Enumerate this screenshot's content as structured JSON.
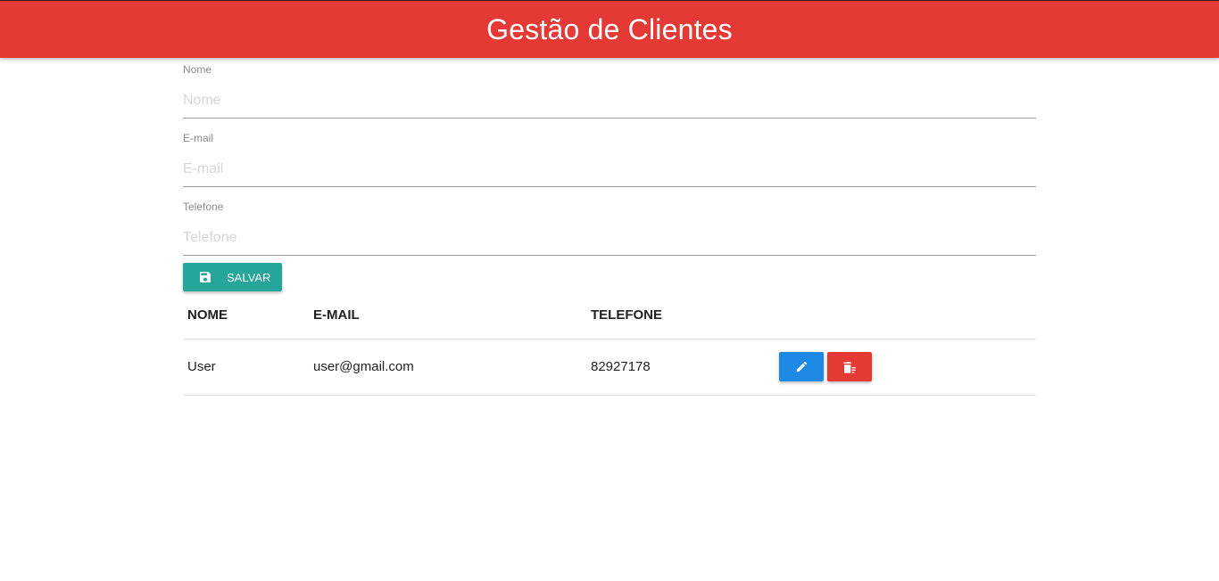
{
  "header": {
    "title": "Gestão de Clientes"
  },
  "form": {
    "nome": {
      "label": "Nome",
      "placeholder": "Nome",
      "value": ""
    },
    "email": {
      "label": "E-mail",
      "placeholder": "E-mail",
      "value": ""
    },
    "telefone": {
      "label": "Telefone",
      "placeholder": "Telefone",
      "value": ""
    },
    "save_label": "SALVAR",
    "save_icon": "save-icon"
  },
  "table": {
    "headers": [
      "NOME",
      "E-MAIL",
      "TELEFONE"
    ],
    "rows": [
      {
        "nome": "User",
        "email": "user@gmail.com",
        "telefone": "82927178"
      }
    ],
    "edit_icon": "pencil-icon",
    "delete_icon": "trash-icon"
  },
  "colors": {
    "header": "#e53935",
    "save": "#26a69a",
    "edit": "#1e88e5",
    "delete": "#e53935"
  }
}
